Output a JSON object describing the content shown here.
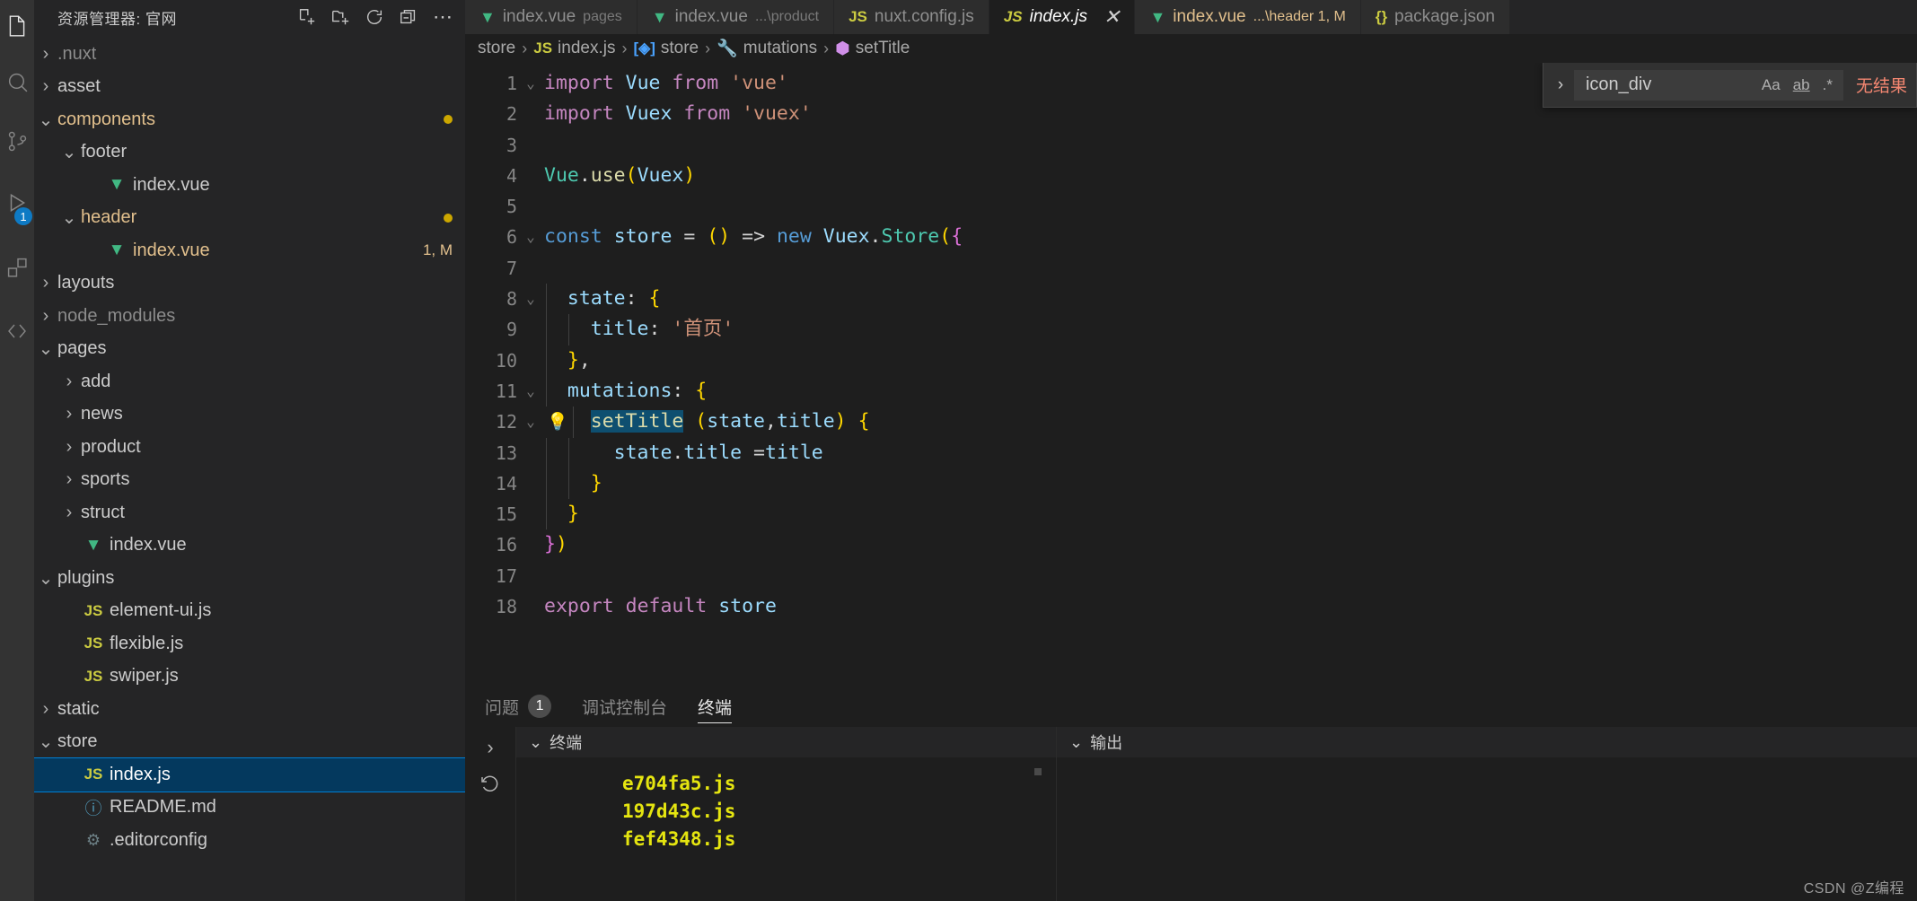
{
  "activitybar": {
    "items": [
      {
        "name": "explorer-icon",
        "badge": null
      },
      {
        "name": "search-icon",
        "badge": null
      },
      {
        "name": "source-control-icon",
        "badge": null
      },
      {
        "name": "run-debug-icon",
        "badge": "1"
      },
      {
        "name": "extensions-icon",
        "badge": null
      },
      {
        "name": "remote-explorer-icon",
        "badge": null
      }
    ]
  },
  "sidebar": {
    "title": "资源管理器: 官网",
    "actions": [
      {
        "name": "new-file-icon",
        "tooltip": "新建文件"
      },
      {
        "name": "new-folder-icon",
        "tooltip": "新建文件夹"
      },
      {
        "name": "refresh-icon",
        "tooltip": "刷新资源管理器"
      },
      {
        "name": "collapse-all-icon",
        "tooltip": "在资源管理器中折叠文件夹"
      },
      {
        "name": "more-actions-icon",
        "tooltip": "视图和更多操作..."
      }
    ],
    "tree": [
      {
        "label": ".nuxt",
        "type": "folder",
        "state": "collapsed",
        "depth": 0,
        "color": "dim",
        "deco": ""
      },
      {
        "label": "asset",
        "type": "folder",
        "state": "collapsed",
        "depth": 0,
        "color": "normal",
        "deco": ""
      },
      {
        "label": "components",
        "type": "folder",
        "state": "expanded",
        "depth": 0,
        "color": "mod",
        "deco": "dot"
      },
      {
        "label": "footer",
        "type": "folder",
        "state": "expanded",
        "depth": 1,
        "color": "normal",
        "deco": ""
      },
      {
        "label": "index.vue",
        "type": "vue",
        "state": "file",
        "depth": 2,
        "color": "normal",
        "deco": ""
      },
      {
        "label": "header",
        "type": "folder",
        "state": "expanded",
        "depth": 1,
        "color": "mod",
        "deco": "dot"
      },
      {
        "label": "index.vue",
        "type": "vue",
        "state": "file",
        "depth": 2,
        "color": "mod",
        "deco": "1, M"
      },
      {
        "label": "layouts",
        "type": "folder",
        "state": "collapsed",
        "depth": 0,
        "color": "normal",
        "deco": ""
      },
      {
        "label": "node_modules",
        "type": "folder",
        "state": "collapsed",
        "depth": 0,
        "color": "dim",
        "deco": ""
      },
      {
        "label": "pages",
        "type": "folder",
        "state": "expanded",
        "depth": 0,
        "color": "normal",
        "deco": ""
      },
      {
        "label": "add",
        "type": "folder",
        "state": "collapsed",
        "depth": 1,
        "color": "normal",
        "deco": ""
      },
      {
        "label": "news",
        "type": "folder",
        "state": "collapsed",
        "depth": 1,
        "color": "normal",
        "deco": ""
      },
      {
        "label": "product",
        "type": "folder",
        "state": "collapsed",
        "depth": 1,
        "color": "normal",
        "deco": ""
      },
      {
        "label": "sports",
        "type": "folder",
        "state": "collapsed",
        "depth": 1,
        "color": "normal",
        "deco": ""
      },
      {
        "label": "struct",
        "type": "folder",
        "state": "collapsed",
        "depth": 1,
        "color": "normal",
        "deco": ""
      },
      {
        "label": "index.vue",
        "type": "vue",
        "state": "file",
        "depth": 1,
        "color": "normal",
        "deco": ""
      },
      {
        "label": "plugins",
        "type": "folder",
        "state": "expanded",
        "depth": 0,
        "color": "normal",
        "deco": ""
      },
      {
        "label": "element-ui.js",
        "type": "js",
        "state": "file",
        "depth": 1,
        "color": "normal",
        "deco": ""
      },
      {
        "label": "flexible.js",
        "type": "js",
        "state": "file",
        "depth": 1,
        "color": "normal",
        "deco": ""
      },
      {
        "label": "swiper.js",
        "type": "js",
        "state": "file",
        "depth": 1,
        "color": "normal",
        "deco": ""
      },
      {
        "label": "static",
        "type": "folder",
        "state": "collapsed",
        "depth": 0,
        "color": "normal",
        "deco": ""
      },
      {
        "label": "store",
        "type": "folder",
        "state": "expanded",
        "depth": 0,
        "color": "normal",
        "deco": ""
      },
      {
        "label": "index.js",
        "type": "js",
        "state": "file",
        "depth": 1,
        "color": "normal",
        "deco": "",
        "selected": true
      },
      {
        "label": "README.md",
        "type": "md",
        "state": "file",
        "depth": 1,
        "color": "normal",
        "deco": ""
      },
      {
        "label": ".editorconfig",
        "type": "gear",
        "state": "file",
        "depth": 1,
        "color": "normal",
        "deco": ""
      }
    ]
  },
  "tabs": [
    {
      "name": "index.vue",
      "desc": "pages",
      "icon": "vue",
      "active": false,
      "modified": false,
      "closable": false
    },
    {
      "name": "index.vue",
      "desc": "...\\product",
      "icon": "vue",
      "active": false,
      "modified": false,
      "closable": false
    },
    {
      "name": "nuxt.config.js",
      "desc": "",
      "icon": "js",
      "active": false,
      "modified": false,
      "closable": false
    },
    {
      "name": "index.js",
      "desc": "",
      "icon": "js",
      "active": true,
      "modified": false,
      "closable": true,
      "close_label": "✕"
    },
    {
      "name": "index.vue",
      "desc": "...\\header 1, M",
      "icon": "vue",
      "active": false,
      "modified": true,
      "closable": false
    },
    {
      "name": "package.json",
      "desc": "",
      "icon": "json",
      "active": false,
      "modified": false,
      "closable": false
    }
  ],
  "breadcrumbs": [
    {
      "label": "store",
      "icon": ""
    },
    {
      "label": "index.js",
      "icon": "js"
    },
    {
      "label": "store",
      "icon": "object"
    },
    {
      "label": "mutations",
      "icon": "wrench"
    },
    {
      "label": "setTitle",
      "icon": "method"
    }
  ],
  "editor": {
    "lines": [
      {
        "n": "1",
        "fold": "v",
        "bulb": false
      },
      {
        "n": "2",
        "fold": "",
        "bulb": false
      },
      {
        "n": "3",
        "fold": "",
        "bulb": false
      },
      {
        "n": "4",
        "fold": "",
        "bulb": false
      },
      {
        "n": "5",
        "fold": "",
        "bulb": false
      },
      {
        "n": "6",
        "fold": "v",
        "bulb": false
      },
      {
        "n": "7",
        "fold": "",
        "bulb": false
      },
      {
        "n": "8",
        "fold": "v",
        "bulb": false
      },
      {
        "n": "9",
        "fold": "",
        "bulb": false
      },
      {
        "n": "10",
        "fold": "",
        "bulb": false
      },
      {
        "n": "11",
        "fold": "v",
        "bulb": false
      },
      {
        "n": "12",
        "fold": "v",
        "bulb": true
      },
      {
        "n": "13",
        "fold": "",
        "bulb": false
      },
      {
        "n": "14",
        "fold": "",
        "bulb": false
      },
      {
        "n": "15",
        "fold": "",
        "bulb": false
      },
      {
        "n": "16",
        "fold": "",
        "bulb": false
      },
      {
        "n": "17",
        "fold": "",
        "bulb": false
      },
      {
        "n": "18",
        "fold": "",
        "bulb": false
      }
    ],
    "source": [
      "import Vue from 'vue'",
      "import Vuex from 'vuex'",
      "",
      "Vue.use(Vuex)",
      "",
      "const store = () => new Vuex.Store({",
      "",
      "  state: {",
      "    title: '首页'",
      "  },",
      "  mutations: {",
      "    setTitle (state,title) {",
      "      state.title =title",
      "    }",
      "  }",
      "})",
      "",
      "export default store"
    ]
  },
  "find": {
    "toggle_icon": "chevron-right-icon",
    "value": "icon_div",
    "placeholder": "查找",
    "options": [
      {
        "name": "match-case-option",
        "label": "Aa"
      },
      {
        "name": "match-whole-word-option",
        "label": "ab"
      },
      {
        "name": "use-regex-option",
        "label": ".*"
      }
    ],
    "result_text": "无结果"
  },
  "panel": {
    "tabs": [
      {
        "label": "问题",
        "badge": "1",
        "active": false
      },
      {
        "label": "调试控制台",
        "badge": null,
        "active": false
      },
      {
        "label": "终端",
        "badge": null,
        "active": true
      }
    ],
    "gutter": [
      {
        "name": "chevron-right-icon"
      },
      {
        "name": "history-icon"
      }
    ],
    "panes": [
      {
        "title": "终端",
        "chevron": "v"
      },
      {
        "title": "输出",
        "chevron": "v"
      }
    ],
    "terminal_lines": [
      "e704fa5.js",
      "197d43c.js",
      "fef4348.js"
    ]
  },
  "watermark": "CSDN @Z编程",
  "colors": {
    "accent": "#007fd4",
    "selection_bg": "#04395e",
    "modified": "#e2c08d",
    "error": "#f48771",
    "terminal_yellow": "#e5e510",
    "badge_blue": "#0e7ac4"
  }
}
